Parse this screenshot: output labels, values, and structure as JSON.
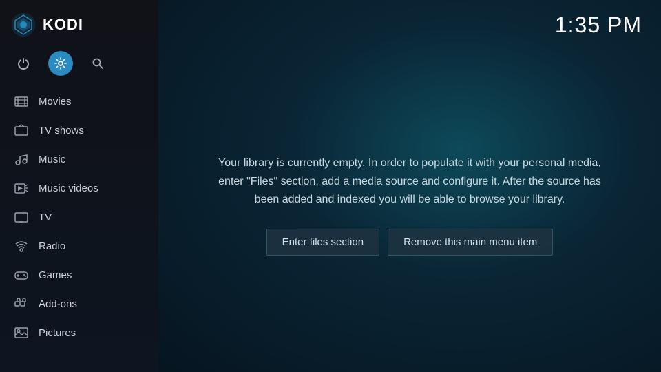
{
  "app": {
    "name": "KODI"
  },
  "clock": {
    "time": "1:35 PM"
  },
  "sidebar": {
    "nav_items": [
      {
        "id": "movies",
        "label": "Movies",
        "icon": "movie"
      },
      {
        "id": "tvshows",
        "label": "TV shows",
        "icon": "tv"
      },
      {
        "id": "music",
        "label": "Music",
        "icon": "music"
      },
      {
        "id": "musicvideos",
        "label": "Music videos",
        "icon": "musicvideo"
      },
      {
        "id": "tv",
        "label": "TV",
        "icon": "tv2"
      },
      {
        "id": "radio",
        "label": "Radio",
        "icon": "radio"
      },
      {
        "id": "games",
        "label": "Games",
        "icon": "games"
      },
      {
        "id": "addons",
        "label": "Add-ons",
        "icon": "addons"
      },
      {
        "id": "pictures",
        "label": "Pictures",
        "icon": "pictures"
      }
    ]
  },
  "main": {
    "message": "Your library is currently empty. In order to populate it with your personal media, enter \"Files\" section, add a media source and configure it. After the source has been added and indexed you will be able to browse your library.",
    "btn_enter_files": "Enter files section",
    "btn_remove_item": "Remove this main menu item"
  }
}
